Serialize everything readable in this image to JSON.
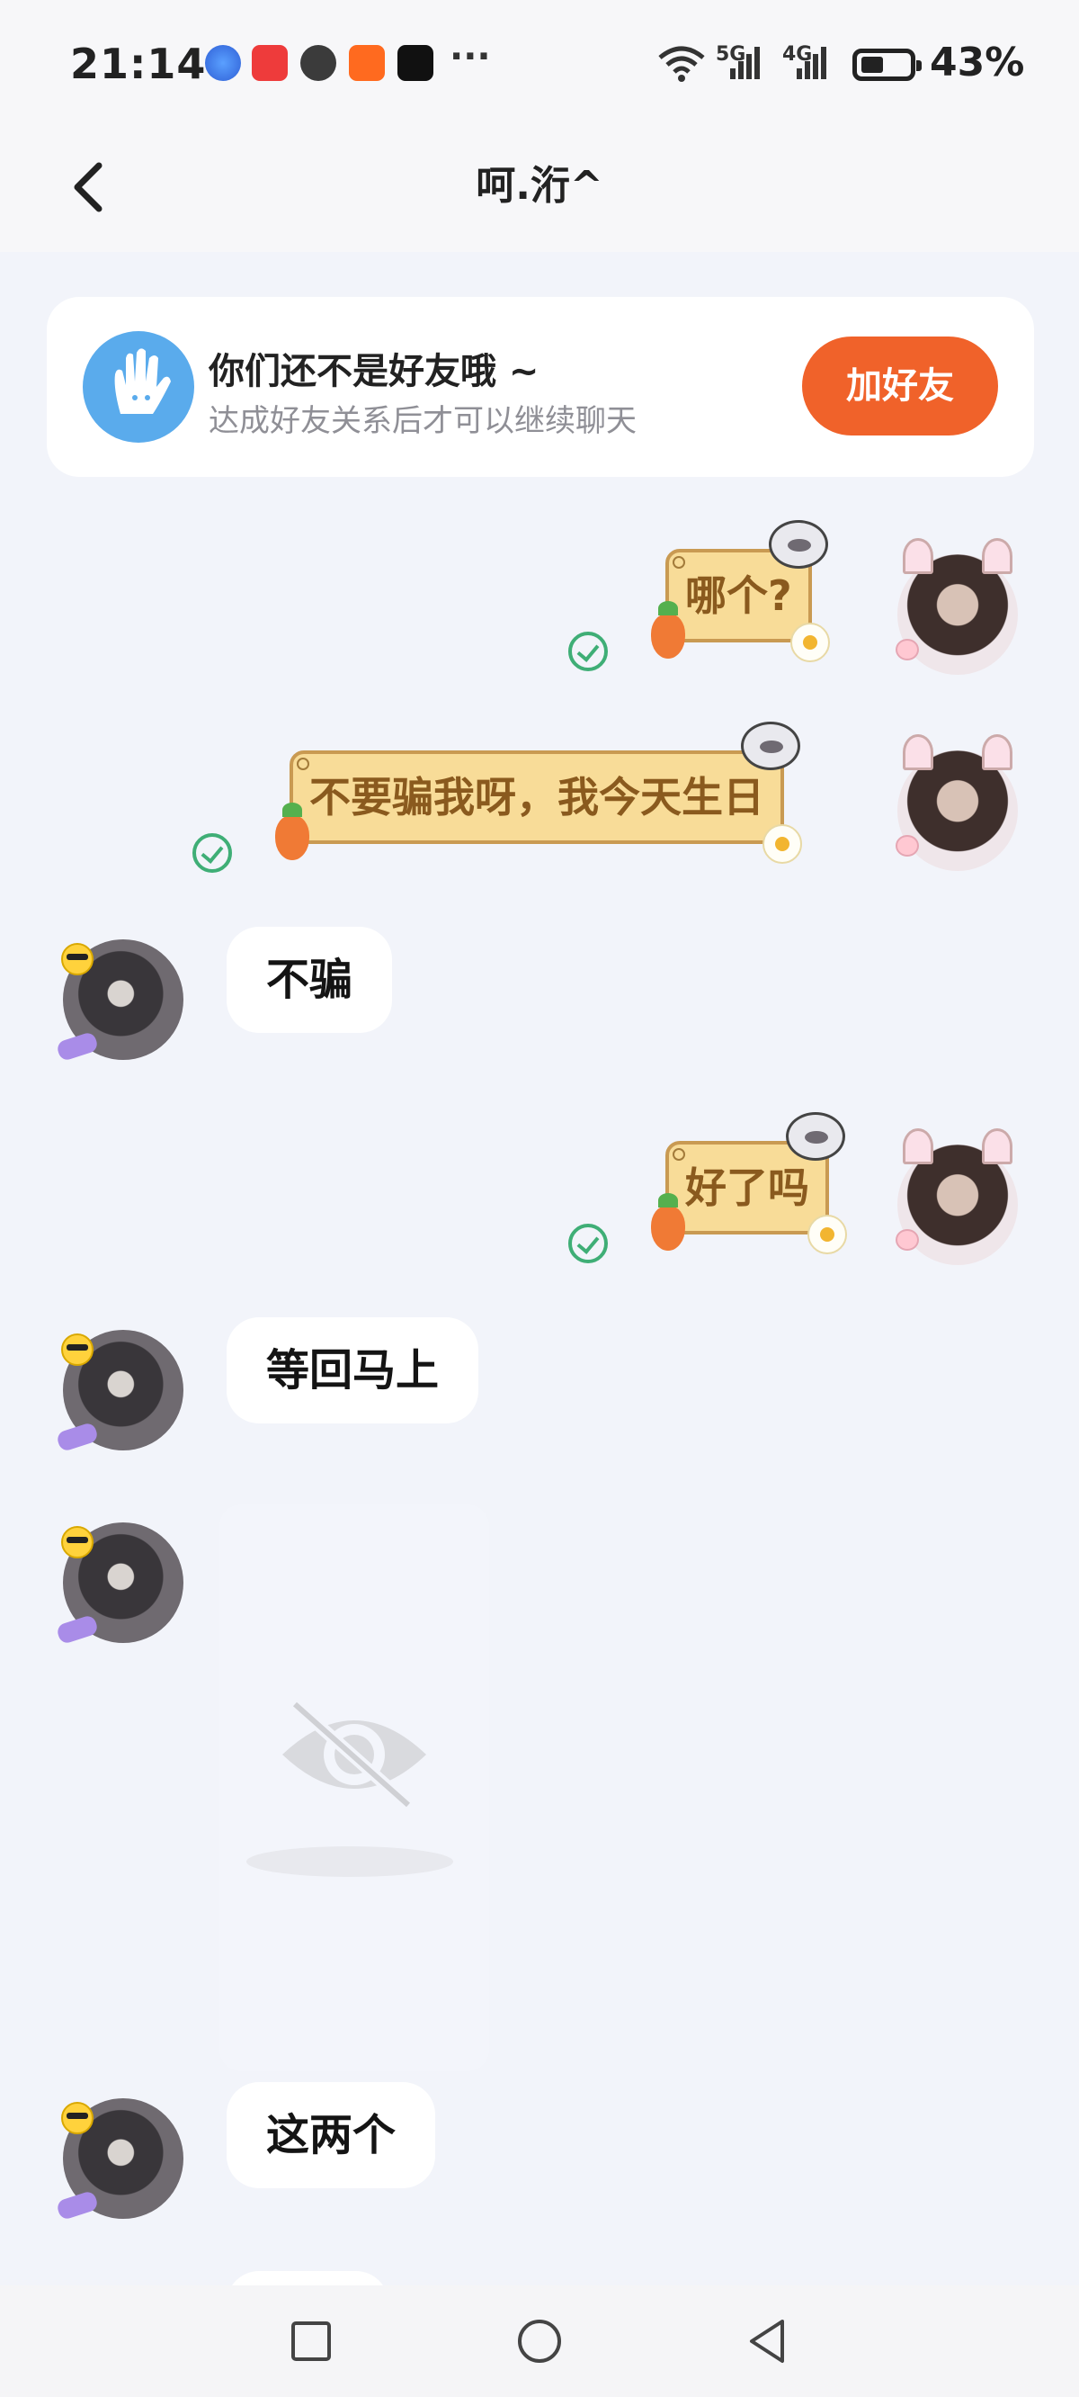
{
  "status_bar": {
    "time": "21:14",
    "wifi_icon": "wifi-icon",
    "signal_1_label": "5G",
    "signal_2_label": "4G",
    "battery": "43%",
    "overflow": "···",
    "notification_icons": [
      "browser-icon",
      "red-app-icon",
      "wechat-icon",
      "kuaishou-icon",
      "tiktok-icon"
    ]
  },
  "header": {
    "title": "呵.洐^",
    "back_icon": "chevron-left-icon"
  },
  "banner": {
    "title": "你们还不是好友哦 ~",
    "subtitle": "达成好友关系后才可以继续聊天",
    "button": "加好友",
    "icon": "hand-wave-icon",
    "accent_color": "#f0622a"
  },
  "messages": [
    {
      "from": "self",
      "type": "sticker-text",
      "text": "哪个?",
      "status": "read"
    },
    {
      "from": "self",
      "type": "sticker-text",
      "text": "不要骗我呀，我今天生日",
      "status": "read"
    },
    {
      "from": "other",
      "type": "text",
      "text": "不骗"
    },
    {
      "from": "self",
      "type": "sticker-text",
      "text": "好了吗",
      "status": "read"
    },
    {
      "from": "other",
      "type": "text",
      "text": "等回马上"
    },
    {
      "from": "other",
      "type": "hidden-image"
    },
    {
      "from": "other",
      "type": "text",
      "text": "这两个"
    }
  ],
  "nav": {
    "recents_icon": "square-icon",
    "home_icon": "circle-icon",
    "back_icon": "triangle-back-icon"
  }
}
